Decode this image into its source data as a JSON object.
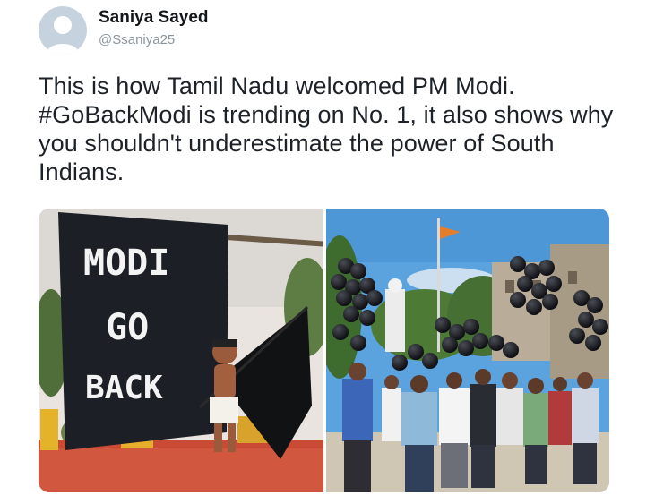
{
  "tweet": {
    "author": {
      "display_name": "Saniya Sayed",
      "handle": "@Ssaniya25"
    },
    "text": "This is how Tamil Nadu welcomed PM Modi. #GoBackModi is trending on No. 1, it also shows why you shouldn't underestimate the power of South Indians.",
    "media": {
      "left_photo": {
        "banner_lines": [
          "MODI",
          "GO",
          "BACK"
        ]
      }
    }
  },
  "colors": {
    "name": "#14171a",
    "handle": "#8a959e",
    "text": "#1d2228",
    "avatar_bg": "#c6d3df",
    "avatar_fg": "#ffffff"
  }
}
